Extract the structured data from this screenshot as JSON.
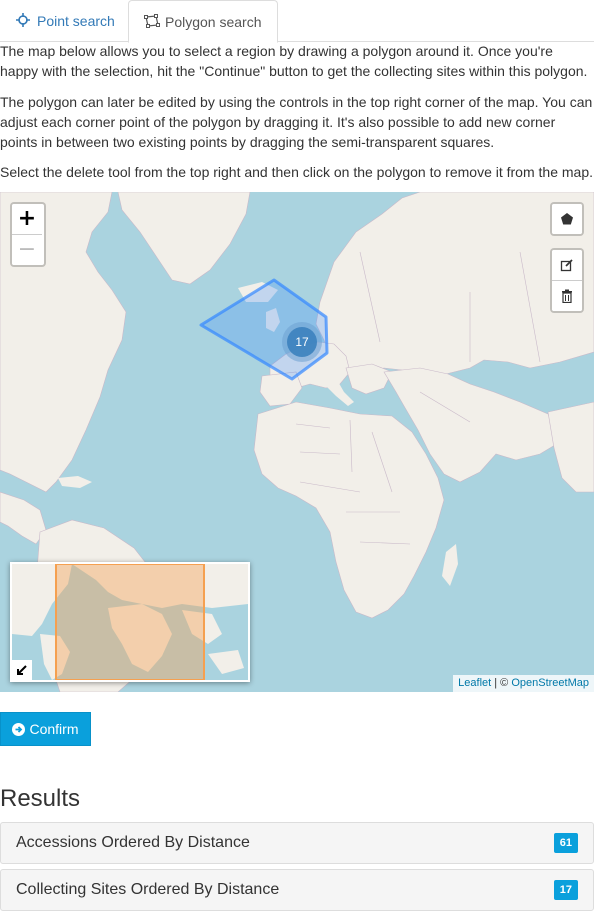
{
  "tabs": [
    {
      "label": "Point search",
      "icon": "crosshairs-icon"
    },
    {
      "label": "Polygon search",
      "icon": "polygon-icon",
      "active": true
    }
  ],
  "intro": {
    "p1": "The map below allows you to select a region by drawing a polygon around it. Once you're happy with the selection, hit the \"Continue\" button to get the collecting sites within this polygon.",
    "p2": "The polygon can later be edited by using the controls in the top right corner of the map. You can adjust each corner point of the polygon by dragging it. It's also possible to add new corner points in between two existing points by dragging the semi-transparent squares.",
    "p3": "Select the delete tool from the top right and then click on the polygon to remove it from the map."
  },
  "map": {
    "zoom_in": "+",
    "zoom_out": "−",
    "cluster_count": "17",
    "attribution_leaflet": "Leaflet",
    "attribution_sep": " | © ",
    "attribution_osm": "OpenStreetMap",
    "colors": {
      "water": "#aad3df",
      "land": "#f2efe9",
      "polygon": "#3388ff",
      "minimap_bounds": "#f5a050"
    }
  },
  "confirm": {
    "label": "Confirm",
    "icon": "circle-arrow-right-icon"
  },
  "results": {
    "title": "Results",
    "items": [
      {
        "label": "Accessions Ordered By Distance",
        "count": "61"
      },
      {
        "label": "Collecting Sites Ordered By Distance",
        "count": "17"
      }
    ]
  },
  "accent": "#0aa0dc"
}
